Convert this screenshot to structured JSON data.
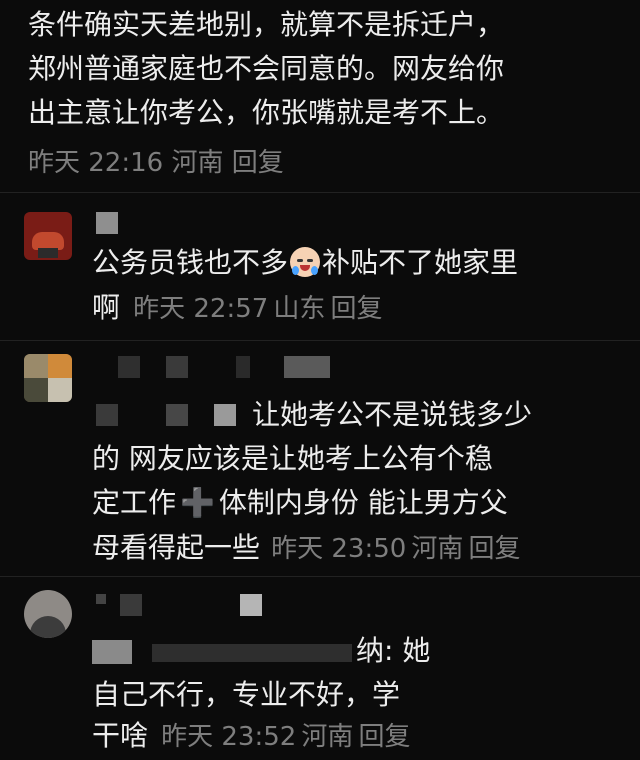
{
  "comment1": {
    "lines": [
      "条件确实天差地别，就算不是拆迁户，",
      "郑州普通家庭也不会同意的。网友给你",
      "出主意让你考公，你张嘴就是考不上。"
    ],
    "time": "昨天 22:16",
    "location": "河南",
    "reply": "回复"
  },
  "comment2": {
    "line1_a": "公务员钱也不多",
    "line1_b": "补贴不了她家里",
    "line2": "啊",
    "emoji": "crying-face-icon",
    "time": "昨天 22:57",
    "location": "山东",
    "reply": "回复"
  },
  "comment3": {
    "line1": "让她考公不是说钱多少",
    "line2": "的 网友应该是让她考上公有个稳",
    "line3_a": "定工作",
    "line3_b": "体制内身份 能让男方父",
    "line4": "母看得起一些",
    "plus": "➕",
    "time": "昨天 23:50",
    "location": "河南",
    "reply": "回复"
  },
  "comment4": {
    "line1_tail": "纳: 她",
    "line2": "自己不行，专业不好，学",
    "line3": "干啥",
    "time": "昨天 23:52",
    "location": "河南",
    "reply": "回复"
  }
}
